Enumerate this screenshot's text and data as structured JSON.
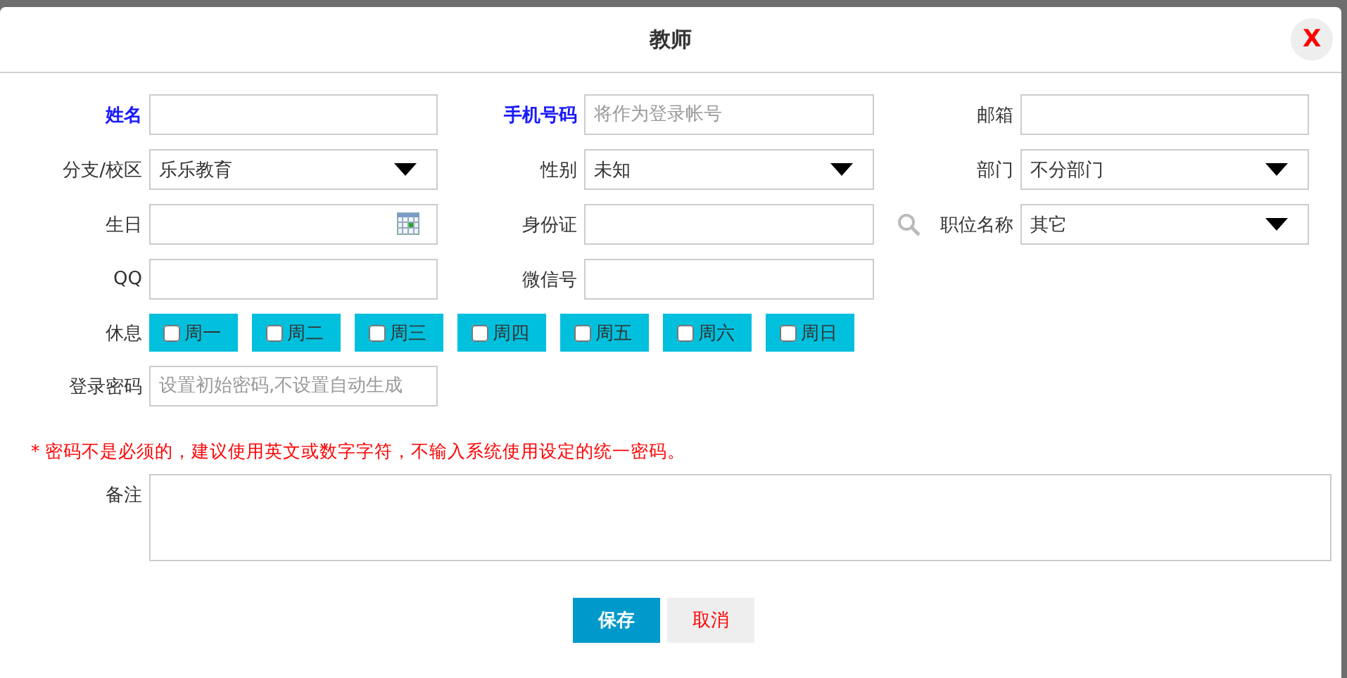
{
  "dialog": {
    "title": "教师",
    "close": "X"
  },
  "rows": [
    [
      {
        "label": "姓名",
        "required": true,
        "kind": "text"
      },
      {
        "label": "手机号码",
        "required": true,
        "kind": "text",
        "placeholder": "将作为登录帐号"
      },
      {
        "label": "邮箱",
        "required": false,
        "kind": "text"
      }
    ],
    [
      {
        "label": "分支/校区",
        "required": false,
        "kind": "select",
        "value": "乐乐教育"
      },
      {
        "label": "性别",
        "required": false,
        "kind": "select",
        "value": "未知"
      },
      {
        "label": "部门",
        "required": false,
        "kind": "select",
        "value": "不分部门"
      }
    ],
    [
      {
        "label": "生日",
        "required": false,
        "kind": "date"
      },
      {
        "label": "身份证",
        "required": false,
        "kind": "text"
      },
      {
        "label": "职位名称",
        "required": false,
        "kind": "select",
        "value": "其它",
        "search": true
      }
    ],
    [
      {
        "label": "QQ",
        "required": false,
        "kind": "text"
      },
      {
        "label": "微信号",
        "required": false,
        "kind": "text"
      }
    ]
  ],
  "rest_days": {
    "label": "休息",
    "days": [
      {
        "label": "周一",
        "checked": false
      },
      {
        "label": "周二",
        "checked": false
      },
      {
        "label": "周三",
        "checked": false
      },
      {
        "label": "周四",
        "checked": false
      },
      {
        "label": "周五",
        "checked": false
      },
      {
        "label": "周六",
        "checked": false
      },
      {
        "label": "周日",
        "checked": false
      }
    ]
  },
  "password": {
    "label": "登录密码",
    "placeholder": "设置初始密码,不设置自动生成"
  },
  "note": "* 密码不是必须的，建议使用英文或数字字符，不输入系统使用设定的统一密码。",
  "remark": {
    "label": "备注"
  },
  "buttons": [
    {
      "label": "保存",
      "kind": "primary"
    },
    {
      "label": "取消",
      "kind": "secondary"
    }
  ]
}
